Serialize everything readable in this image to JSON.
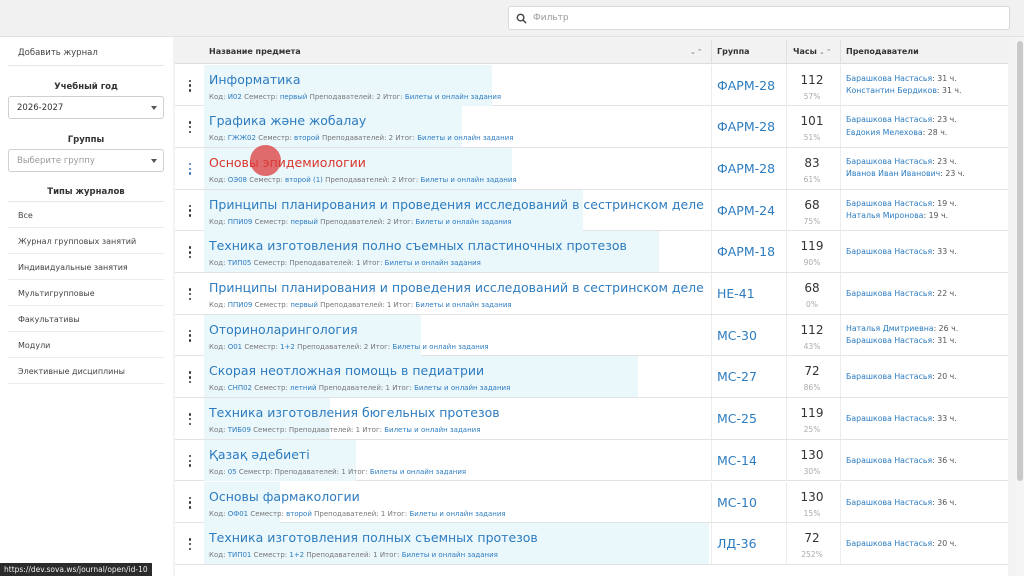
{
  "search": {
    "placeholder": "Фильтр",
    "value": ""
  },
  "sidebar": {
    "add_journal": "Добавить журнал",
    "year_label": "Учебный год",
    "year_value": "2026-2027",
    "groups_label": "Группы",
    "groups_placeholder": "Выберите группу",
    "types_label": "Типы журналов",
    "types": [
      "Все",
      "Журнал групповых занятий",
      "Индивидуальные занятия",
      "Мультигрупповые",
      "Факультативы",
      "Модули",
      "Элективные дисциплины"
    ]
  },
  "table": {
    "headers": {
      "subject": "Название предмета",
      "group": "Группа",
      "hours": "Часы",
      "teachers": "Преподаватели"
    },
    "meta_labels": {
      "code": "Код:",
      "semester": "Семестр:",
      "teachers": "Преподавателей:",
      "result": "Итог:"
    },
    "rows": [
      {
        "title": "Информатика",
        "code": "И02",
        "semester": "первый",
        "teachers_count": "2",
        "result": "Билеты и онлайн задания",
        "group": "ФАРМ-28",
        "hours": "112",
        "pct": "57%",
        "fill": 0.57,
        "teachers": [
          {
            "name": "Барашкова Настасья",
            "hours": ": 31 ч."
          },
          {
            "name": "Константин Бердиков",
            "hours": ": 31 ч."
          }
        ]
      },
      {
        "title": "Графика және жобалау",
        "code": "ГЖЖ02",
        "semester": "второй",
        "teachers_count": "2",
        "result": "Билеты и онлайн задания",
        "group": "ФАРМ-28",
        "hours": "101",
        "pct": "51%",
        "fill": 0.51,
        "teachers": [
          {
            "name": "Барашкова Настасья",
            "hours": ": 23 ч."
          },
          {
            "name": "Евдокия Мелехова",
            "hours": ": 28 ч."
          }
        ]
      },
      {
        "title": "Основы эпидемиологии",
        "code": "ОЭ08",
        "semester": "второй (1)",
        "teachers_count": "2",
        "result": "Билеты и онлайн задания",
        "group": "ФАРМ-28",
        "hours": "83",
        "pct": "61%",
        "fill": 0.61,
        "active": true,
        "teachers": [
          {
            "name": "Барашкова Настасья",
            "hours": ": 23 ч."
          },
          {
            "name": "Иванов Иван Иванович",
            "hours": ": 23 ч."
          }
        ]
      },
      {
        "title": "Принципы планирования и проведения исследований в сестринском деле",
        "code": "ППИ09",
        "semester": "первый",
        "teachers_count": "2",
        "result": "Билеты и онлайн задания",
        "group": "ФАРМ-24",
        "hours": "68",
        "pct": "75%",
        "fill": 0.75,
        "teachers": [
          {
            "name": "Барашкова Настасья",
            "hours": ": 19 ч."
          },
          {
            "name": "Наталья Миронова",
            "hours": ": 19 ч."
          }
        ]
      },
      {
        "title": "Техника изготовления полно съемных пластиночных протезов",
        "code": "ТИП05",
        "semester": "",
        "teachers_count": "1",
        "result": "Билеты и онлайн задания",
        "group": "ФАРМ-18",
        "hours": "119",
        "pct": "90%",
        "fill": 0.9,
        "teachers": [
          {
            "name": "Барашкова Настасья",
            "hours": ": 33 ч."
          }
        ]
      },
      {
        "title": "Принципы планирования и проведения исследований в сестринском деле",
        "code": "ППИ09",
        "semester": "первый",
        "teachers_count": "1",
        "result": "Билеты и онлайн задания",
        "group": "НЕ-41",
        "hours": "68",
        "pct": "0%",
        "fill": 0,
        "teachers": [
          {
            "name": "Барашкова Настасья",
            "hours": ": 22 ч."
          }
        ]
      },
      {
        "title": "Оториноларингология",
        "code": "О01",
        "semester": "1+2",
        "teachers_count": "2",
        "result": "Билеты и онлайн задания",
        "group": "МС-30",
        "hours": "112",
        "pct": "43%",
        "fill": 0.43,
        "teachers": [
          {
            "name": "Наталья Дмитриевна",
            "hours": ": 26 ч."
          },
          {
            "name": "Барашкова Настасья",
            "hours": ": 31 ч."
          }
        ]
      },
      {
        "title": "Скорая неотложная помощь в педиатрии",
        "code": "СНП02",
        "semester": "летний",
        "teachers_count": "1",
        "result": "Билеты и онлайн задания",
        "group": "МС-27",
        "hours": "72",
        "pct": "86%",
        "fill": 0.86,
        "teachers": [
          {
            "name": "Барашкова Настасья",
            "hours": ": 20 ч."
          }
        ]
      },
      {
        "title": "Техника изготовления бюгельных протезов",
        "code": "ТИБ09",
        "semester": "",
        "teachers_count": "1",
        "result": "Билеты и онлайн задания",
        "group": "МС-25",
        "hours": "119",
        "pct": "25%",
        "fill": 0.25,
        "teachers": [
          {
            "name": "Барашкова Настасья",
            "hours": ": 33 ч."
          }
        ]
      },
      {
        "title": "Қазақ әдебиеті",
        "code": "05",
        "semester": "",
        "teachers_count": "1",
        "result": "Билеты и онлайн задания",
        "group": "МС-14",
        "hours": "130",
        "pct": "30%",
        "fill": 0.3,
        "teachers": [
          {
            "name": "Барашкова Настасья",
            "hours": ": 36 ч."
          }
        ]
      },
      {
        "title": "Основы фармакологии",
        "code": "ОФ01",
        "semester": "второй",
        "teachers_count": "1",
        "result": "Билеты и онлайн задания",
        "group": "МС-10",
        "hours": "130",
        "pct": "15%",
        "fill": 0.15,
        "teachers": [
          {
            "name": "Барашкова Настасья",
            "hours": ": 36 ч."
          }
        ]
      },
      {
        "title": "Техника изготовления полных съемных протезов",
        "code": "ТИП01",
        "semester": "1+2",
        "teachers_count": "1",
        "result": "Билеты и онлайн задания",
        "group": "ЛД-36",
        "hours": "72",
        "pct": "252%",
        "fill": 1,
        "teachers": [
          {
            "name": "Барашкова Настасья",
            "hours": ": 20 ч."
          }
        ]
      }
    ]
  },
  "status_url": "https://dev.sova.ws/journal/open/id-10",
  "colors": {
    "link": "#2d7cc0",
    "active": "#d9352b",
    "progress": "#eaf7fb"
  },
  "icons": {
    "search": "search-icon",
    "menu": "kebab-menu-icon",
    "caret": "caret-down-icon",
    "sort": "sort-arrows-icon"
  }
}
